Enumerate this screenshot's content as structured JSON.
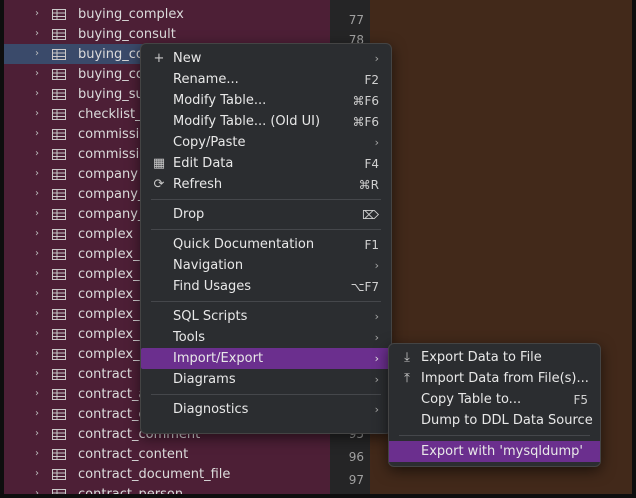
{
  "tree": {
    "items": [
      {
        "label": "buying_complex"
      },
      {
        "label": "buying_consult"
      },
      {
        "label": "buying_cor"
      },
      {
        "label": "buying_cor"
      },
      {
        "label": "buying_sur"
      },
      {
        "label": "checklist_t"
      },
      {
        "label": "commission"
      },
      {
        "label": "commission"
      },
      {
        "label": "company"
      },
      {
        "label": "company_g"
      },
      {
        "label": "company_g"
      },
      {
        "label": "complex"
      },
      {
        "label": "complex_c"
      },
      {
        "label": "complex_c"
      },
      {
        "label": "complex_e"
      },
      {
        "label": "complex_la"
      },
      {
        "label": "complex_m"
      },
      {
        "label": "complex_s"
      },
      {
        "label": "contract"
      },
      {
        "label": "contract_ar"
      },
      {
        "label": "contract_cl"
      },
      {
        "label": "contract_comment"
      },
      {
        "label": "contract_content"
      },
      {
        "label": "contract_document_file"
      },
      {
        "label": "contract_person"
      }
    ],
    "selected_index": 2,
    "expand_glyph": "›",
    "item_icon": "table-icon"
  },
  "gutter": {
    "top_numbers": [
      "77",
      "78"
    ],
    "bottom_numbers": [
      "95",
      "96",
      "97"
    ]
  },
  "context_menu": {
    "items": [
      {
        "icon": "+",
        "label": "New",
        "arrow": "›"
      },
      {
        "label": "Rename...",
        "shortcut": "F2"
      },
      {
        "label": "Modify Table...",
        "shortcut": "⌘F6"
      },
      {
        "label": "Modify Table... (Old UI)",
        "shortcut": "⌘F6"
      },
      {
        "label": "Copy/Paste",
        "arrow": "›"
      },
      {
        "icon": "▦",
        "label": "Edit Data",
        "shortcut": "F4"
      },
      {
        "icon": "⟳",
        "label": "Refresh",
        "shortcut": "⌘R"
      },
      {
        "label": "Drop",
        "shortcut": "⌦"
      },
      {
        "label": "Quick Documentation",
        "shortcut": "F1"
      },
      {
        "label": "Navigation",
        "arrow": "›"
      },
      {
        "label": "Find Usages",
        "shortcut": "⌥F7"
      },
      {
        "label": "SQL Scripts",
        "arrow": "›"
      },
      {
        "label": "Tools",
        "arrow": "›"
      },
      {
        "label": "Import/Export",
        "arrow": "›"
      },
      {
        "label": "Diagrams",
        "arrow": "›"
      },
      {
        "label": "Diagnostics",
        "arrow": "›"
      }
    ],
    "highlighted": "Import/Export"
  },
  "submenu": {
    "items": [
      {
        "icon": "⤓",
        "label": "Export Data to File"
      },
      {
        "icon": "⤒",
        "label": "Import Data from File(s)..."
      },
      {
        "label": "Copy Table to...",
        "shortcut": "F5"
      },
      {
        "label": "Dump to DDL Data Source"
      },
      {
        "label": "Export with 'mysqldump'"
      }
    ],
    "highlighted": "Export with 'mysqldump'"
  },
  "colors": {
    "tree_bg": "#4d1f36",
    "selection": "#3a4a6a",
    "menu_bg": "#2b2d30",
    "highlight": "#6b2f8e",
    "editor_bg": "#42291a"
  }
}
